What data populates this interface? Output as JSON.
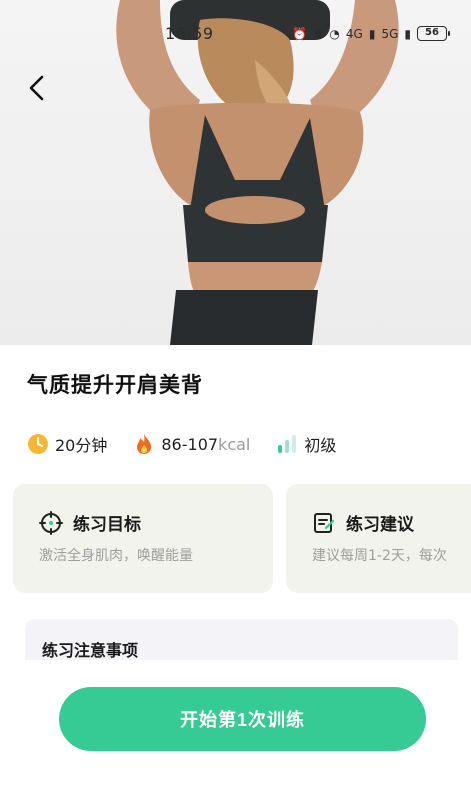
{
  "status_bar": {
    "time": "16:59",
    "network_4g": "4G",
    "network_5g": "5G",
    "battery": "56"
  },
  "workout": {
    "title": "气质提升开肩美背",
    "duration": "20分钟",
    "calories_value": "86-107",
    "calories_unit": "kcal",
    "level": "初级"
  },
  "cards": [
    {
      "title": "练习目标",
      "desc": "激活全身肌肉，唤醒能量",
      "icon": "target-icon"
    },
    {
      "title": "练习建议",
      "desc": "建议每周1-2天，每次",
      "icon": "note-icon"
    }
  ],
  "notes": {
    "title": "练习注意事项"
  },
  "start_button": {
    "label": "开始第1次训练"
  },
  "colors": {
    "accent": "#36cb94",
    "card_bg": "#f3f3ee",
    "clock": "#f5b731",
    "fire": "#f06a1a"
  }
}
